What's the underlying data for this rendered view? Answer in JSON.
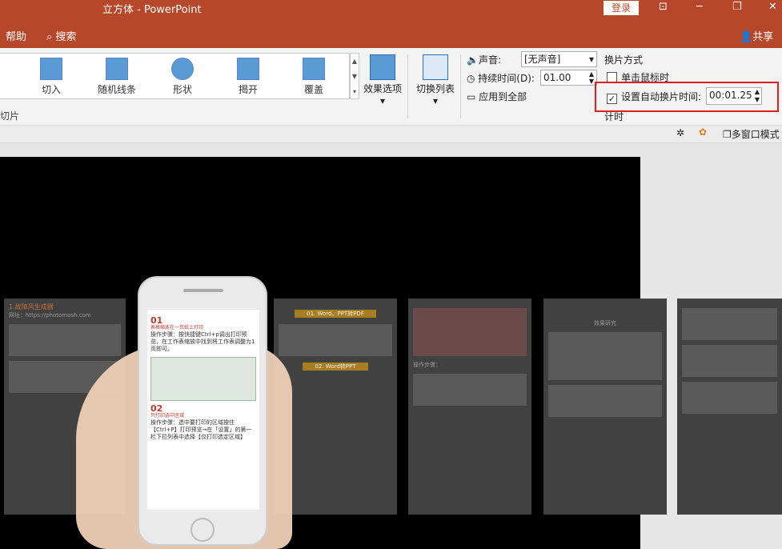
{
  "window": {
    "title": "立方体  -  PowerPoint",
    "login": "登录",
    "min": "─",
    "restore": "❐",
    "close": "✕",
    "ribbon_toggle": "⊡"
  },
  "tabs": {
    "help": "帮助",
    "search": "搜索",
    "share": "共享"
  },
  "gallery": {
    "items": [
      "切入",
      "随机线条",
      "形状",
      "揭开",
      "覆盖"
    ],
    "group_label": "切片"
  },
  "buttons": {
    "effect_options": "效果选项",
    "transition_list": "切换列表"
  },
  "timing": {
    "sound_label": "声音:",
    "sound_value": "[无声音]",
    "duration_label": "持续时间(D):",
    "duration_value": "01.00",
    "apply_all": "应用到全部",
    "advance_header": "换片方式",
    "on_click": "单击鼠标时",
    "auto_advance": "设置自动换片时间:",
    "auto_advance_value": "00:01.25",
    "group_label": "计时"
  },
  "quickbar": {
    "multi_window": "多窗口模式"
  },
  "slides": {
    "p1_title": "1.故障风生成器",
    "p1_url": "网址：https://photomosh.com",
    "p2_title": "01. Word、PPT转PDF",
    "p2_tag": "02. Word转PPT",
    "p3_label": "操作步骤：",
    "p5_title": "效果研究"
  },
  "phone": {
    "h1": "01",
    "s1": "表格缩放在一页纸上打印",
    "t1": "操作步骤：按快捷键Ctrl+p调出打印预览，在工作表缩放中找到将工作表调整为1页即可。",
    "h2": "02",
    "s2": "只打印选中区域",
    "t2": "操作步骤：选中要打印的区域按住【Ctrl+P】打印预览→在「设置」的第一栏下拉列表中选择【仅打印选定区域】"
  },
  "colors": {
    "accent": "#b7472a",
    "highlight": "#e02020"
  }
}
